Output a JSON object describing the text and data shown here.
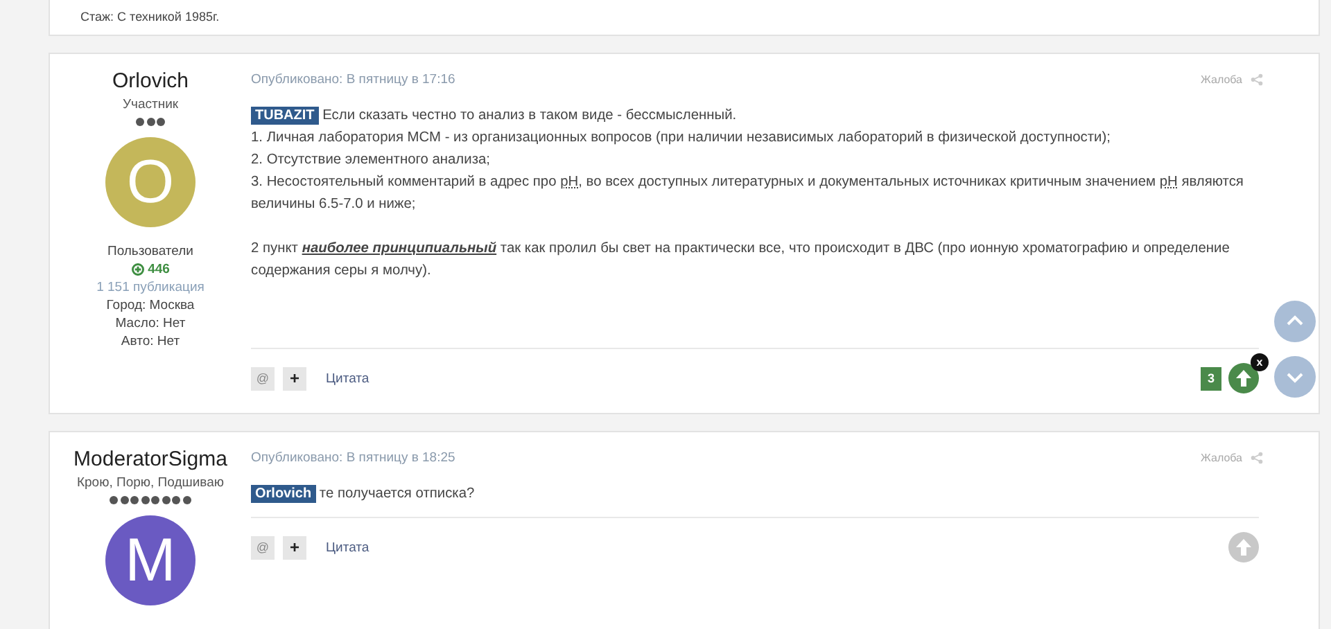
{
  "prev_post_footer": {
    "text": "Стаж: С техникой 1985г."
  },
  "posts": [
    {
      "author": {
        "name": "Orlovich",
        "rank": "Участник",
        "stars": 3,
        "avatar_letter": "O",
        "color": "#c4b75a",
        "group": "Пользователи",
        "reputation": "446",
        "posts_count": "1 151 публикация",
        "fields": [
          "Город: Москва",
          "Масло: Нет",
          "Авто: Нет"
        ]
      },
      "published": "Опубликовано: В пятницу в 17:16",
      "report": "Жалоба",
      "lines": [
        {
          "mention": "TUBAZIT",
          "segments": [
            {
              "kind": "plain",
              "text": "Если сказать честно то анализ в таком виде - бессмысленный."
            }
          ]
        },
        {
          "segments": [
            {
              "kind": "plain",
              "text": "1. Личная лаборатория МСМ - из организационных вопросов (при наличии независимых лабораторий в физической доступности);"
            }
          ]
        },
        {
          "segments": [
            {
              "kind": "plain",
              "text": "2. Отсутствие элементного анализа;"
            }
          ]
        },
        {
          "segments": [
            {
              "kind": "plain",
              "text": "3. Несостоятельный комментарий в адрес про "
            },
            {
              "kind": "abbr",
              "text": "pH"
            },
            {
              "kind": "plain",
              "text": ", во всех доступных литературных и документальных источниках критичным значением "
            },
            {
              "kind": "abbr",
              "text": "pH"
            },
            {
              "kind": "plain",
              "text": " являются величины 6.5-7.0 и ниже;"
            }
          ]
        },
        {
          "gap": true,
          "segments": [
            {
              "kind": "plain",
              "text": "2 пункт "
            },
            {
              "kind": "emph",
              "text": "наиболее принципиальный"
            },
            {
              "kind": "plain",
              "text": " так как пролил бы свет на практически все, что происходит в ДВС (про ионную хроматографию и определение содержания серы я молчу)."
            }
          ]
        }
      ],
      "actions": {
        "mention": "@",
        "multiquote": "+",
        "quote": "Цитата"
      },
      "reaction": {
        "count": "3",
        "upvoted": true,
        "remove": "x"
      }
    },
    {
      "author": {
        "name": "ModeratorSigma",
        "rank": "Крою, Порю, Подшиваю",
        "stars": 8,
        "avatar_letter": "M",
        "color": "#6a5ac2"
      },
      "published": "Опубликовано: В пятницу в 18:25",
      "report": "Жалоба",
      "lines": [
        {
          "mention": "Orlovich",
          "segments": [
            {
              "kind": "plain",
              "text": "те получается отписка?"
            }
          ]
        }
      ],
      "actions": {
        "mention": "@",
        "multiquote": "+",
        "quote": "Цитата"
      },
      "reaction": {
        "upvoted": false
      }
    }
  ]
}
